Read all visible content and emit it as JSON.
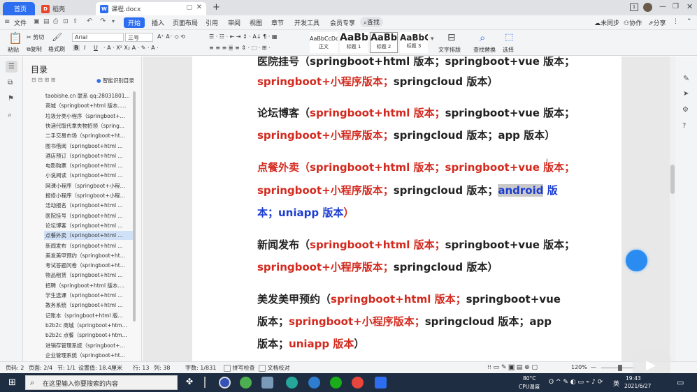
{
  "titlebar": {
    "tabs": [
      {
        "label": "首页"
      },
      {
        "label": "稻壳"
      },
      {
        "label": "课程.docx"
      }
    ],
    "new_tab": "+",
    "badge": "1"
  },
  "ribbon": {
    "file_menu": "文件",
    "tabs": [
      "开始",
      "插入",
      "页面布局",
      "引用",
      "审阅",
      "视图",
      "章节",
      "开发工具",
      "会员专享"
    ],
    "search": "查找",
    "sync": "未同步",
    "collab": "协作",
    "share": "分享"
  },
  "toolbar": {
    "paste": "粘贴",
    "cut": "剪切",
    "copy": "复制",
    "format_painter": "格式刷",
    "font_name": "Arial",
    "font_size": "三号",
    "styles": [
      {
        "sample": "AaBbCcDd",
        "label": "正文"
      },
      {
        "sample": "AaBb",
        "label": "标题 1"
      },
      {
        "sample": "AaBbC",
        "label": "标题 2"
      },
      {
        "sample": "AaBbC",
        "label": "标题 3"
      }
    ],
    "text_layout": "文字排版",
    "find_replace": "查找替换",
    "select": "选择"
  },
  "toc": {
    "title": "目录",
    "smart_button": "智能识别目录",
    "items": [
      "taobishe.cn 联系 qq:28031801...",
      "商城（springboot+html 版本.....",
      "垃圾分类小程序（springboot+...",
      "快递代取代拿失物招领（spring...",
      "二手交易市场（springboot+ht...",
      "图书借阅（springboot+html ...",
      "酒店预订（springboot+html ...",
      "电影购票（springboot+html ...",
      "小说阅读（springboot+html ...",
      "网课小程序（springboot+小程...",
      "报修小程序（springboot+小程...",
      "活动报名（springboot+html ...",
      "医院挂号（springboot+html ...",
      "论坛博客（springboot+html ...",
      "点餐外卖（springboot+html ...",
      "新闻发布（springboot+html ...",
      "美发美甲预约（springboot+ht...",
      "考试答题问卷（springboot+ht...",
      "物品租赁（springboot+html ...",
      "招聘（springboot+html 版本....",
      "学生选课（springboot+html ...",
      "教务系统（springboot+html ...",
      "记账本（springboot+html 版...",
      "b2b2c 商城（springboot+htm...",
      "b2b2c 点餐（springboot+htm...",
      "进销存管理系统（springboot+...",
      "企业管理系统（springboot+ht..."
    ],
    "selected_index": 14
  },
  "document": {
    "lines": [
      {
        "segments": [
          {
            "t": "医院挂号（springboot+html 版本；springboot+vue 版本；",
            "c": "k"
          }
        ]
      },
      {
        "segments": [
          {
            "t": "springboot+小程序版本；",
            "c": "r"
          },
          {
            "t": "springcloud 版本）",
            "c": "k"
          }
        ]
      },
      {
        "segments": [
          {
            "t": "论坛博客（",
            "c": "k"
          },
          {
            "t": "springboot+html 版本；",
            "c": "r"
          },
          {
            "t": "springboot+vue 版本；",
            "c": "k"
          }
        ]
      },
      {
        "segments": [
          {
            "t": "springboot+小程序版本；",
            "c": "r"
          },
          {
            "t": "springcloud 版本；app 版本）",
            "c": "k"
          }
        ]
      },
      {
        "segments": [
          {
            "t": "点餐外卖（springboot+html 版本；springboot+vue 版本；",
            "c": "r"
          }
        ]
      },
      {
        "segments": [
          {
            "t": "springboot+小程序版本；",
            "c": "r"
          },
          {
            "t": "springcloud 版本；",
            "c": "k"
          },
          {
            "t": "android",
            "c": "b hl"
          },
          {
            "t": " 版",
            "c": "b"
          }
        ]
      },
      {
        "segments": [
          {
            "t": "本；uniapp 版本",
            "c": "b"
          },
          {
            "t": "）",
            "c": "r"
          }
        ]
      },
      {
        "segments": [
          {
            "t": "新闻发布（",
            "c": "k"
          },
          {
            "t": "springboot+html 版本；",
            "c": "r"
          },
          {
            "t": "springboot+vue 版本；",
            "c": "k"
          }
        ]
      },
      {
        "segments": [
          {
            "t": "springboot+小程序版本；",
            "c": "r"
          },
          {
            "t": "springcloud 版本）",
            "c": "k"
          }
        ]
      },
      {
        "segments": [
          {
            "t": "美发美甲预约（",
            "c": "k"
          },
          {
            "t": "springboot+html 版本；",
            "c": "r"
          },
          {
            "t": "springboot+vue",
            "c": "k"
          }
        ]
      },
      {
        "segments": [
          {
            "t": "版本；",
            "c": "k"
          },
          {
            "t": "springboot+小程序版本；",
            "c": "r"
          },
          {
            "t": "springcloud 版本；app",
            "c": "k"
          }
        ]
      },
      {
        "segments": [
          {
            "t": "版本；",
            "c": "k"
          },
          {
            "t": "uniapp 版本",
            "c": "r"
          },
          {
            "t": "）",
            "c": "k"
          }
        ]
      }
    ]
  },
  "statusbar": {
    "page_num": "页码: 2",
    "pages": "页面: 2/4",
    "section": "节: 1/1",
    "setting": "设置值: 18.4厘米",
    "row": "行: 13",
    "col": "列: 38",
    "word_count": "字数: 1/831",
    "spell_check": "拼写检查",
    "doc_proof": "文档校对",
    "zoom": "120%"
  },
  "taskbar": {
    "search_placeholder": "在这里输入你要搜索的内容",
    "temp": "80°C",
    "temp_label": "CPU温度",
    "time": "19:43",
    "date": "2021/6/27",
    "lang": "英"
  }
}
